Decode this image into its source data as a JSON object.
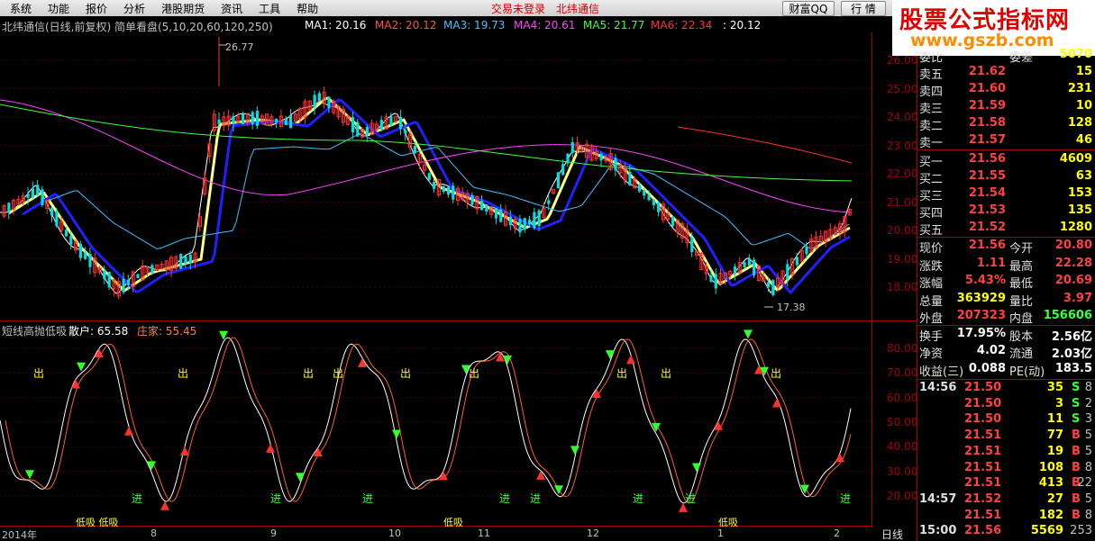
{
  "menu": {
    "items": [
      "系统",
      "功能",
      "报价",
      "分析",
      "港股期货",
      "资讯",
      "工具",
      "帮助"
    ],
    "trade_status": "交易未登录",
    "broker": "北纬通信",
    "btn_wealth": "财富QQ",
    "btn_market": "行 情",
    "win_controls": [
      "_",
      "□",
      "×"
    ]
  },
  "watermark": {
    "line1": "股票公式指标网",
    "line2": "www.gszb.com"
  },
  "header": {
    "title": "北纬通信(日线,前复权) 简单看盘(5,10,20,60,120,250)",
    "ma": [
      {
        "label": "MA1: 20.16",
        "color": "#ffffff"
      },
      {
        "label": "MA2: 20.12",
        "color": "#ff5050"
      },
      {
        "label": "MA3: 19.73",
        "color": "#40c0ff"
      },
      {
        "label": "MA4: 20.61",
        "color": "#ff40ff"
      },
      {
        "label": "MA5: 21.77",
        "color": "#40ff40"
      },
      {
        "label": "MA6: 22.34",
        "color": "#ff3030"
      }
    ],
    "ma_last": ": 20.12",
    "colors": {
      "title": "#c0c0c0"
    }
  },
  "main_chart": {
    "price_axis": [
      "26.00",
      "25.00",
      "24.00",
      "23.00",
      "22.00",
      "21.00",
      "20.00",
      "19.00",
      "18.00"
    ],
    "high_label": "26.77",
    "low_label": "17.38"
  },
  "indicator": {
    "title": "短线高抛低吸",
    "retail": "散户: 65.58",
    "banker": "庄家: 55.45",
    "axis": [
      "80.00",
      "70.00",
      "60.00",
      "50.00",
      "40.00",
      "30.00",
      "20.00"
    ],
    "label_out": "出",
    "label_in": "进",
    "label_dip": "低吸",
    "label_dip_pair": "低吸 低吸"
  },
  "dates": [
    "2014年",
    "8",
    "9",
    "10",
    "11",
    "12",
    "1",
    "2"
  ],
  "period": "日线",
  "quote": {
    "top_partial": {
      "label": "委比",
      "value": "",
      "label2": "委差",
      "vol": "5070"
    },
    "asks": [
      {
        "label": "卖五",
        "price": "21.62",
        "vol": "15"
      },
      {
        "label": "卖四",
        "price": "21.60",
        "vol": "231"
      },
      {
        "label": "卖三",
        "price": "21.59",
        "vol": "10"
      },
      {
        "label": "卖二",
        "price": "21.58",
        "vol": "128"
      },
      {
        "label": "卖一",
        "price": "21.57",
        "vol": "46"
      }
    ],
    "bids": [
      {
        "label": "买一",
        "price": "21.56",
        "vol": "4609"
      },
      {
        "label": "买二",
        "price": "21.55",
        "vol": "63"
      },
      {
        "label": "买三",
        "price": "21.54",
        "vol": "153"
      },
      {
        "label": "买四",
        "price": "21.53",
        "vol": "135"
      },
      {
        "label": "买五",
        "price": "21.52",
        "vol": "1280"
      }
    ],
    "stats": [
      {
        "l1": "现价",
        "v1": "21.56",
        "c1": "#ff4040",
        "l2": "今开",
        "v2": "20.80",
        "c2": "#ff4040"
      },
      {
        "l1": "涨跌",
        "v1": "1.11",
        "c1": "#ff4040",
        "l2": "最高",
        "v2": "22.28",
        "c2": "#ff4040"
      },
      {
        "l1": "涨幅",
        "v1": "5.43%",
        "c1": "#ff4040",
        "l2": "最低",
        "v2": "20.69",
        "c2": "#ff4040"
      },
      {
        "l1": "总量",
        "v1": "363929",
        "c1": "#ffff00",
        "l2": "量比",
        "v2": "3.97",
        "c2": "#ff4040"
      },
      {
        "l1": "外盘",
        "v1": "207323",
        "c1": "#ff4040",
        "l2": "内盘",
        "v2": "156606",
        "c2": "#40ff40"
      },
      {
        "l1": "换手",
        "v1": "17.95%",
        "c1": "#ffffff",
        "l2": "股本",
        "v2": "2.56亿",
        "c2": "#ffffff"
      },
      {
        "l1": "净资",
        "v1": "4.02",
        "c1": "#ffffff",
        "l2": "流通",
        "v2": "2.03亿",
        "c2": "#ffffff"
      },
      {
        "l1": "收益(三)",
        "v1": "0.088",
        "c1": "#ffffff",
        "l2": "PE(动)",
        "v2": "183.5",
        "c2": "#ffffff"
      }
    ],
    "ticks": [
      {
        "time": "14:56",
        "price": "21.50",
        "vol": "35",
        "side": "S",
        "num": "8"
      },
      {
        "time": "",
        "price": "21.50",
        "vol": "3",
        "side": "S",
        "num": "2"
      },
      {
        "time": "",
        "price": "21.50",
        "vol": "11",
        "side": "S",
        "num": "3"
      },
      {
        "time": "",
        "price": "21.51",
        "vol": "77",
        "side": "B",
        "num": "5"
      },
      {
        "time": "",
        "price": "21.51",
        "vol": "19",
        "side": "B",
        "num": "5"
      },
      {
        "time": "",
        "price": "21.51",
        "vol": "108",
        "side": "B",
        "num": "8"
      },
      {
        "time": "",
        "price": "21.51",
        "vol": "413",
        "side": "B",
        "num": "22"
      },
      {
        "time": "14:57",
        "price": "21.52",
        "vol": "27",
        "side": "B",
        "num": "5"
      },
      {
        "time": "",
        "price": "21.51",
        "vol": "182",
        "side": "B",
        "num": "8"
      },
      {
        "time": "15:00",
        "price": "21.56",
        "vol": "5569",
        "side": "",
        "num": "253"
      }
    ]
  }
}
